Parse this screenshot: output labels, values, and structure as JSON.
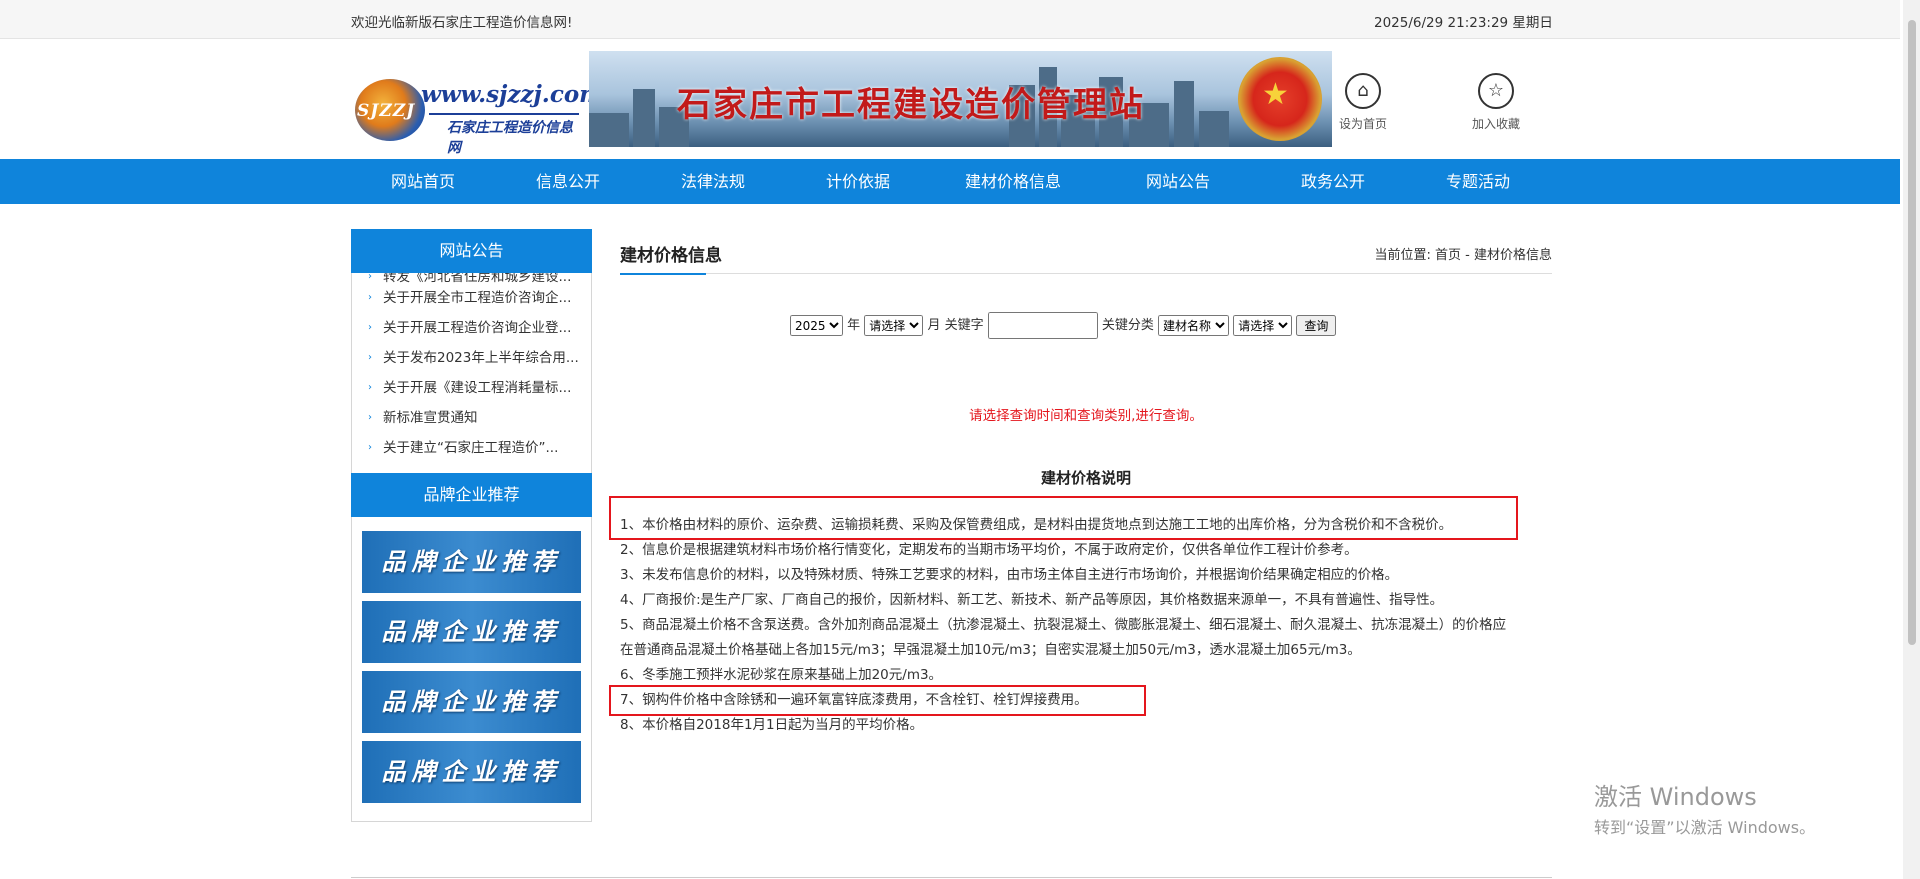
{
  "topbar": {
    "welcome": "欢迎光临新版石家庄工程造价信息网!",
    "datetime": "2025/6/29 21:23:29 星期日"
  },
  "logo": {
    "abbr": "SJZZJ",
    "url": "www.sjzzj.com",
    "subtitle": "石家庄工程造价信息网"
  },
  "banner": {
    "title": "石家庄市工程建设造价管理站"
  },
  "header_buttons": {
    "home": "设为首页",
    "favorite": "加入收藏"
  },
  "nav": [
    "网站首页",
    "信息公开",
    "法律法规",
    "计价依据",
    "建材价格信息",
    "网站公告",
    "政务公开",
    "专题活动"
  ],
  "sidebar": {
    "notice_title": "网站公告",
    "notices": [
      "转发《河北省住房和城乡建设...",
      "关于开展全市工程造价咨询企...",
      "关于开展工程造价咨询企业登...",
      "关于发布2023年上半年综合用...",
      "关于开展《建设工程消耗量标...",
      "新标准宣贯通知",
      "关于建立“石家庄工程造价”..."
    ],
    "brand_title": "品牌企业推荐",
    "brand_banner_text": "品牌企业推荐"
  },
  "main": {
    "title": "建材价格信息",
    "breadcrumb": "当前位置: 首页 - 建材价格信息",
    "search": {
      "year": "2025",
      "year_label": "年",
      "month": "请选择",
      "month_label": "月",
      "keyword_label": "关键字",
      "keyword_value": "",
      "category_label": "关键分类",
      "category": "建材名称",
      "subcategory": "请选择",
      "button": "查询"
    },
    "warning": "请选择查询时间和查询类别,进行查询。",
    "explain_title": "建材价格说明",
    "lines": [
      "1、本价格由材料的原价、运杂费、运输损耗费、采购及保管费组成，是材料由提货地点到达施工工地的出库价格，分为含税价和不含税价。",
      "2、信息价是根据建筑材料市场价格行情变化，定期发布的当期市场平均价，不属于政府定价，仅供各单位作工程计价参考。",
      "3、未发布信息价的材料，以及特殊材质、特殊工艺要求的材料，由市场主体自主进行市场询价，并根据询价结果确定相应的价格。",
      "4、厂商报价:是生产厂家、厂商自己的报价，因新材料、新工艺、新技术、新产品等原因，其价格数据来源单一，不具有普遍性、指导性。",
      "5、商品混凝土价格不含泵送费。含外加剂商品混凝土（抗渗混凝土、抗裂混凝土、微膨胀混凝土、细石混凝土、耐久混凝土、抗冻混凝土）的价格应",
      "在普通商品混凝土价格基础上各加15元/m3；早强混凝土加10元/m3；自密实混凝土加50元/m3，透水混凝土加65元/m3。",
      "6、冬季施工预拌水泥砂浆在原来基础上加20元/m3。",
      "7、钢构件价格中含除锈和一遍环氧富锌底漆费用，不含栓钉、栓钉焊接费用。",
      "8、本价格自2018年1月1日起为当月的平均价格。"
    ]
  },
  "watermark": {
    "line1": "激活 Windows",
    "line2": "转到“设置”以激活 Windows。"
  },
  "colors": {
    "nav_blue": "#0f84db",
    "warning_red": "#e4161d"
  }
}
